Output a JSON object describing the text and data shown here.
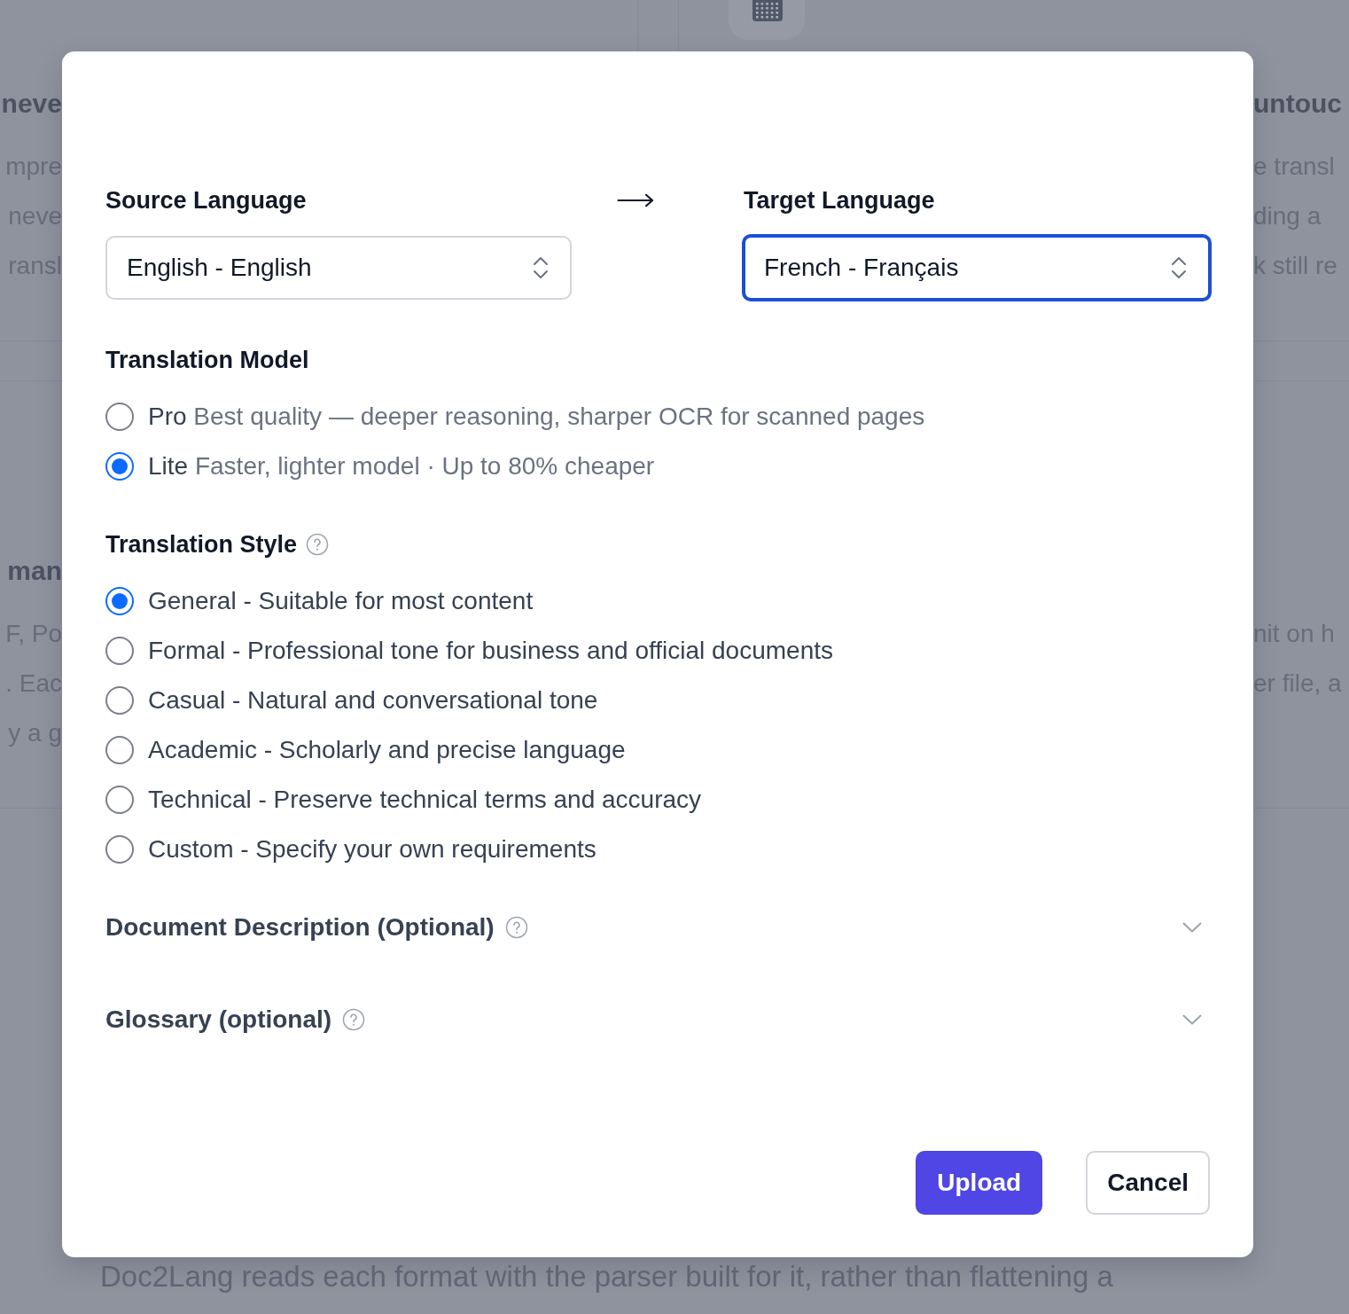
{
  "background": {
    "left_blocks": [
      {
        "heading": "neve",
        "lines": [
          "mpre",
          "neve",
          "ransl"
        ]
      },
      {
        "heading": "man",
        "lines": [
          "F, Po",
          ". Eac",
          "y a g"
        ]
      }
    ],
    "right_blocks": [
      {
        "heading": "untouc",
        "lines": [
          "e transl",
          "ding a",
          "k still re"
        ]
      },
      {
        "lines": [
          "nit on h",
          "er file, a"
        ]
      }
    ],
    "footer_text": "Doc2Lang reads each format with the parser built for it, rather than flattening a"
  },
  "dialog": {
    "source": {
      "label": "Source Language",
      "value": "English - English",
      "focused": false
    },
    "target": {
      "label": "Target Language",
      "value": "French - Français",
      "focused": true
    },
    "model": {
      "label": "Translation Model",
      "options": [
        {
          "name": "Pro",
          "description": "Best quality — deeper reasoning, sharper OCR for scanned pages",
          "selected": false
        },
        {
          "name": "Lite",
          "description": "Faster, lighter model · Up to 80% cheaper",
          "selected": true
        }
      ]
    },
    "style": {
      "label": "Translation Style",
      "options": [
        {
          "label": "General - Suitable for most content",
          "selected": true
        },
        {
          "label": "Formal - Professional tone for business and official documents",
          "selected": false
        },
        {
          "label": "Casual - Natural and conversational tone",
          "selected": false
        },
        {
          "label": "Academic - Scholarly and precise language",
          "selected": false
        },
        {
          "label": "Technical - Preserve technical terms and accuracy",
          "selected": false
        },
        {
          "label": "Custom - Specify your own requirements",
          "selected": false
        }
      ]
    },
    "sections": [
      {
        "title": "Document Description (Optional)",
        "expanded": false
      },
      {
        "title": "Glossary (optional)",
        "expanded": false
      }
    ],
    "buttons": [
      {
        "label": "Upload",
        "kind": "primary"
      },
      {
        "label": "Cancel",
        "kind": "secondary"
      }
    ]
  }
}
